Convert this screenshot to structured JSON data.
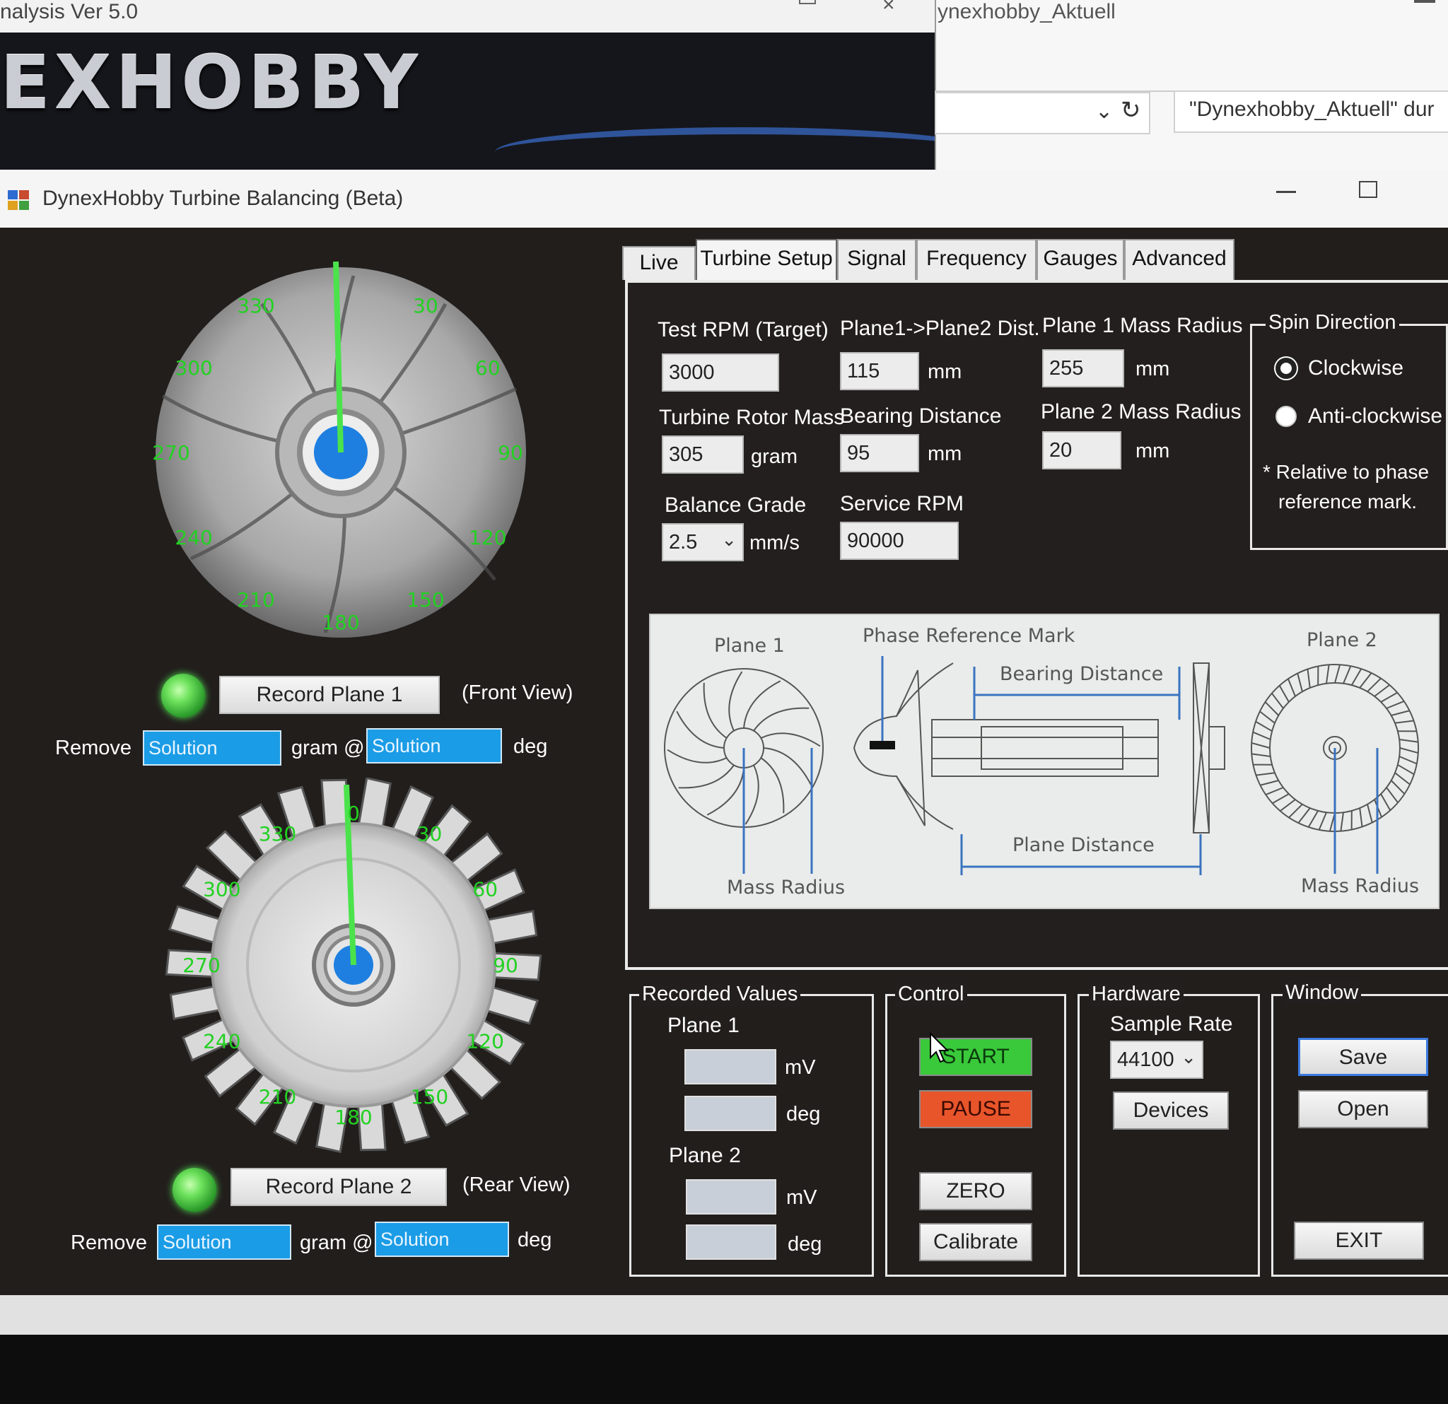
{
  "background_app": {
    "title": "nalysis Ver 5.0",
    "logo": "EXHOBBY"
  },
  "background_explorer": {
    "title": "ynexhobby_Aktuell",
    "search_placeholder": "\"Dynexhobby_Aktuell\" dur"
  },
  "window": {
    "title": "DynexHobby Turbine Balancing (Beta)"
  },
  "plane1": {
    "angles": [
      "330",
      "30",
      "300",
      "60",
      "270",
      "90",
      "240",
      "120",
      "210",
      "150",
      "180"
    ],
    "record_label": "Record Plane 1",
    "view_label": "(Front View)",
    "remove_label": "Remove",
    "gram_at_label": "gram @",
    "deg_label": "deg",
    "mass_value": "Solution",
    "angle_value": "Solution"
  },
  "plane2": {
    "angles": [
      "330",
      "30",
      "300",
      "60",
      "270",
      "90",
      "240",
      "120",
      "210",
      "150",
      "180",
      "0"
    ],
    "record_label": "Record Plane 2",
    "view_label": "(Rear View)",
    "remove_label": "Remove",
    "gram_at_label": "gram @",
    "deg_label": "deg",
    "mass_value": "Solution",
    "angle_value": "Solution"
  },
  "tabs": [
    "Live",
    "Turbine Setup",
    "Signal",
    "Frequency",
    "Gauges",
    "Advanced"
  ],
  "setup": {
    "test_rpm_label": "Test RPM (Target)",
    "test_rpm": "3000",
    "plane_dist_label": "Plane1->Plane2 Dist.",
    "plane_dist": "115",
    "plane_dist_unit": "mm",
    "p1_radius_label": "Plane 1 Mass Radius",
    "p1_radius": "255",
    "p1_radius_unit": "mm",
    "rotor_mass_label": "Turbine Rotor Mass",
    "rotor_mass": "305",
    "rotor_mass_unit": "gram",
    "bearing_label": "Bearing Distance",
    "bearing": "95",
    "bearing_unit": "mm",
    "p2_radius_label": "Plane 2 Mass Radius",
    "p2_radius": "20",
    "p2_radius_unit": "mm",
    "grade_label": "Balance Grade",
    "grade": "2.5",
    "grade_unit": "mm/s",
    "service_rpm_label": "Service RPM",
    "service_rpm": "90000"
  },
  "spin": {
    "title": "Spin Direction",
    "cw": "Clockwise",
    "ccw": "Anti-clockwise",
    "note_line1": "* Relative to phase",
    "note_line2": "reference mark.",
    "selected": "Clockwise"
  },
  "diagram": {
    "plane1": "Plane 1",
    "phase_mark": "Phase Reference Mark",
    "plane2": "Plane 2",
    "bearing": "Bearing Distance",
    "plane_distance": "Plane Distance",
    "mass_radius_left": "Mass Radius",
    "mass_radius_right": "Mass Radius"
  },
  "recorded": {
    "title": "Recorded Values",
    "plane1": "Plane 1",
    "plane2": "Plane 2",
    "mv": "mV",
    "deg": "deg"
  },
  "control": {
    "title": "Control",
    "start": "START",
    "pause": "PAUSE",
    "zero": "ZERO",
    "calibrate": "Calibrate"
  },
  "hardware": {
    "title": "Hardware",
    "sample_rate_label": "Sample Rate",
    "sample_rate": "44100",
    "devices": "Devices"
  },
  "window_group": {
    "title": "Window",
    "save": "Save",
    "open": "Open",
    "exit": "EXIT"
  },
  "colors": {
    "accent_green": "#22d122",
    "solution_blue": "#1b9ce6",
    "start_green": "#39c93a",
    "pause_red": "#e8552b",
    "hub_blue": "#1e7fe0"
  }
}
